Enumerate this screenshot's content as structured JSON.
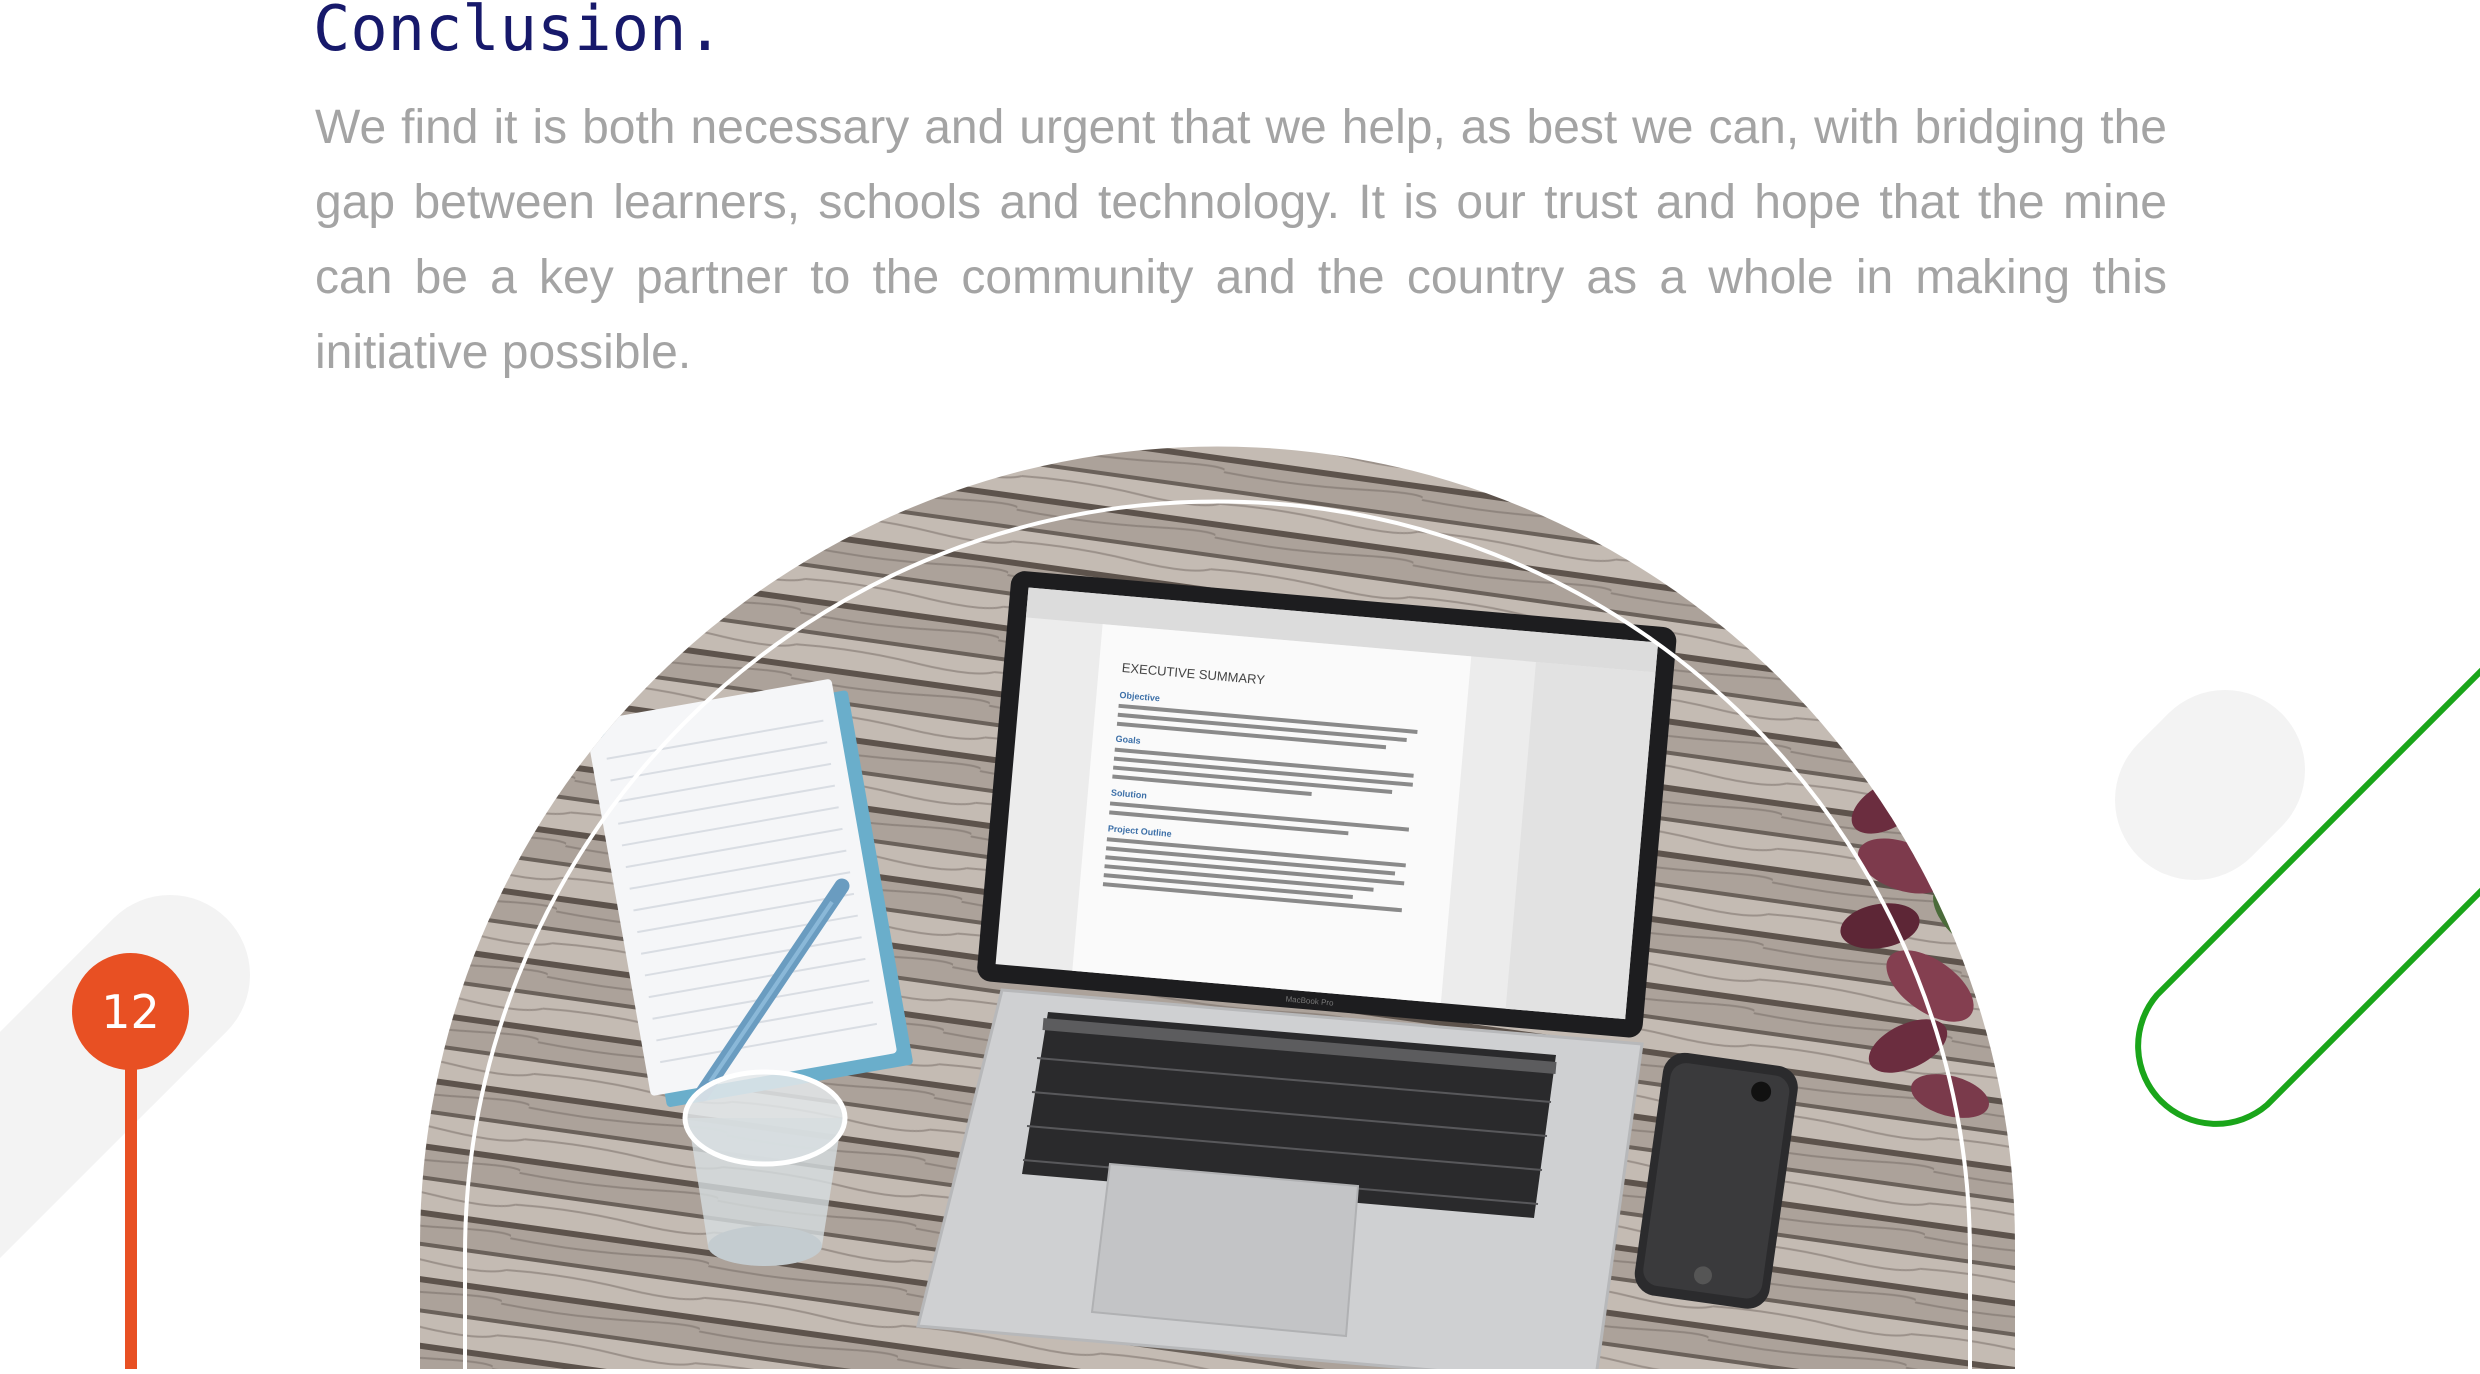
{
  "section": {
    "heading": "Conclusion.",
    "paragraph": "We find it is both necessary and urgent that we help, as best we can, with bridging the gap between learners, schools and technology. It is our trust and hope that the mine can be a key partner to the community and the country as a whole in making this initiative possible."
  },
  "photo": {
    "laptop_screen": {
      "document_title": "EXECUTIVE SUMMARY",
      "headings": [
        "Objective",
        "Goals",
        "Solution",
        "Project Outline"
      ]
    },
    "laptop_brand": "MacBook Pro"
  },
  "page": {
    "number": "12"
  },
  "colors": {
    "heading": "#17196b",
    "body_text": "#a4a4a4",
    "accent_orange": "#e85023",
    "accent_green": "#1aa51a",
    "soft_gray": "#f3f3f3"
  }
}
